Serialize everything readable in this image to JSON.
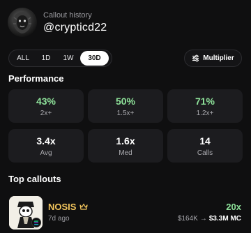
{
  "header": {
    "subtitle": "Callout history",
    "handle": "@crypticd22",
    "avatar_icon": "lion-avatar-icon"
  },
  "time_tabs": {
    "items": [
      "ALL",
      "1D",
      "1W",
      "30D"
    ],
    "selected": "30D"
  },
  "multiplier_button": {
    "label": "Multiplier",
    "icon": "sliders-icon"
  },
  "performance": {
    "title": "Performance",
    "hit_rates": [
      {
        "value": "43%",
        "label": "2x+"
      },
      {
        "value": "50%",
        "label": "1.5x+"
      },
      {
        "value": "71%",
        "label": "1.2x+"
      }
    ],
    "stats": [
      {
        "value": "3.4x",
        "label": "Avg"
      },
      {
        "value": "1.6x",
        "label": "Med"
      },
      {
        "value": "14",
        "label": "Calls"
      }
    ]
  },
  "top_callouts": {
    "title": "Top callouts",
    "items": [
      {
        "name": "NOSIS",
        "age": "7d ago",
        "multiplier": "20x",
        "mc_from": "$164K",
        "mc_to": "$3.3M",
        "mc_unit": "MC",
        "chain_icon": "solana-icon",
        "badge_icon": "crown-icon"
      }
    ]
  },
  "colors": {
    "background": "#0f0f10",
    "card": "#1c1c1f",
    "positive": "#8ee29a",
    "token_name": "#f2c55c"
  }
}
